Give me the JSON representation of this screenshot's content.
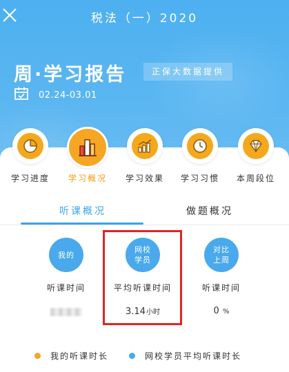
{
  "header": {
    "title": "税法（一）2020",
    "week_title": "周·学习报告",
    "badge": "正保大数据提供",
    "date_range": "02.24-03.01"
  },
  "nav": {
    "items": [
      {
        "label": "学习进度",
        "icon": "pie-chart-icon"
      },
      {
        "label": "学习概况",
        "icon": "bar-chart-icon"
      },
      {
        "label": "学习效果",
        "icon": "trend-chart-icon"
      },
      {
        "label": "学习习惯",
        "icon": "clock-icon"
      },
      {
        "label": "本周段位",
        "icon": "diamond-icon"
      }
    ],
    "active_index": 1
  },
  "tabs": [
    {
      "label": "听课概况"
    },
    {
      "label": "做题概况"
    }
  ],
  "stats": [
    {
      "circle": "我的",
      "label": "听课时间",
      "value": ""
    },
    {
      "circle": "网校\n学员",
      "label": "平均听课时间",
      "value": "3.14",
      "unit": "小时"
    },
    {
      "circle": "对比\n上周",
      "label": "听课时间",
      "value": "0",
      "unit": "%"
    }
  ],
  "legend": [
    {
      "label": "我的听课时长",
      "color": "#f5a623"
    },
    {
      "label": "网校学员平均听课时长",
      "color": "#4aa9ec"
    }
  ],
  "colors": {
    "header_blue": "#4db0f0",
    "accent_orange": "#f6a623",
    "tab_blue": "#3aa4ec",
    "highlight_red": "#e02424"
  }
}
